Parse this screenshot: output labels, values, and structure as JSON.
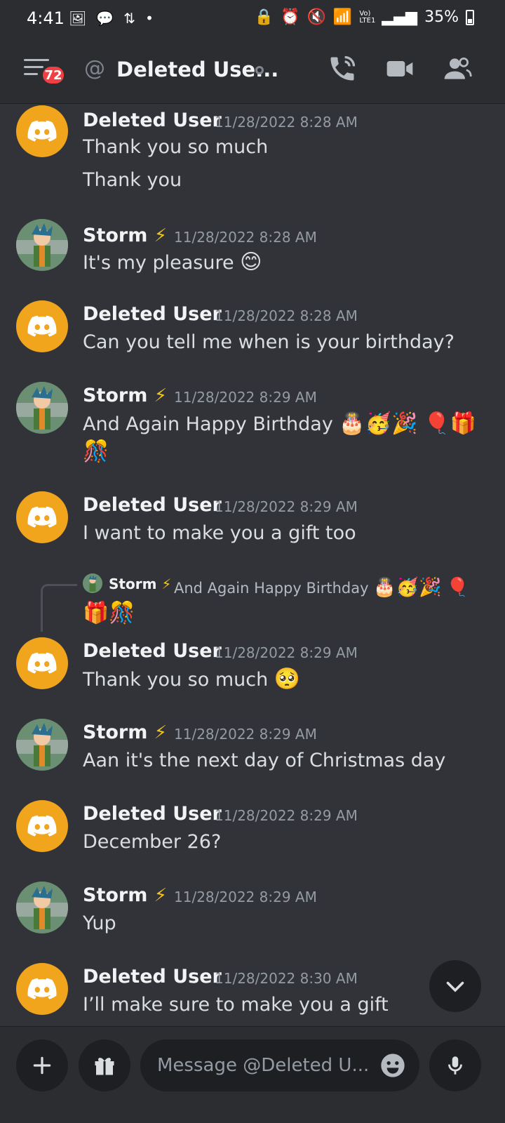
{
  "status_bar": {
    "time": "4:41",
    "battery": "35%",
    "network": "Vo) LTE1"
  },
  "header": {
    "unread_badge": "72",
    "title": "Deleted Use..."
  },
  "messages": [
    {
      "author": "Deleted User",
      "timestamp": "11/28/2022 8:28 AM",
      "lines": [
        "Thank you so much",
        "Thank you"
      ]
    },
    {
      "author": "Storm",
      "timestamp": "11/28/2022 8:28 AM",
      "lines": [
        "It's my pleasure"
      ]
    },
    {
      "author": "Deleted User",
      "timestamp": "11/28/2022 8:28 AM",
      "lines": [
        "Can you tell me when is your birthday?"
      ]
    },
    {
      "author": "Storm",
      "timestamp": "11/28/2022 8:29 AM",
      "lines": [
        "And Again Happy Birthday"
      ]
    },
    {
      "author": "Deleted User",
      "timestamp": "11/28/2022 8:29 AM",
      "lines": [
        "I want to make you a gift too"
      ]
    },
    {
      "author": "Deleted User",
      "timestamp": "11/28/2022 8:29 AM",
      "lines": [
        "Thank you so much"
      ]
    },
    {
      "author": "Storm",
      "timestamp": "11/28/2022 8:29 AM",
      "lines": [
        "Aan it's the next day of Christmas day"
      ]
    },
    {
      "author": "Deleted User",
      "timestamp": "11/28/2022 8:29 AM",
      "lines": [
        "December 26?"
      ]
    },
    {
      "author": "Storm",
      "timestamp": "11/28/2022 8:29 AM",
      "lines": [
        "Yup"
      ]
    },
    {
      "author": "Deleted User",
      "timestamp": "11/28/2022 8:30 AM",
      "lines": [
        "I’ll make sure to make you a gift"
      ]
    }
  ],
  "reply": {
    "author": "Storm",
    "text": "And Again Happy Birthday"
  },
  "composer": {
    "placeholder": "Message @Deleted U..."
  },
  "colors": {
    "background": "#313338",
    "header": "#2b2d31",
    "discord_avatar": "#f0a51c",
    "badge": "#f23f43"
  }
}
